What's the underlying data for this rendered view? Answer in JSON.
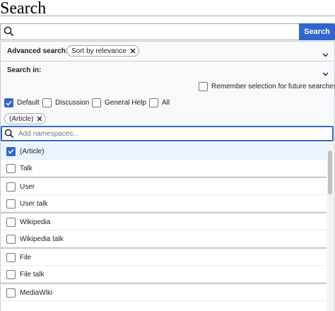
{
  "page": {
    "title": "Search"
  },
  "search": {
    "value": "",
    "button_label": "Search"
  },
  "advanced": {
    "label": "Advanced search:",
    "chip_label": "Sort by relevance"
  },
  "search_in": {
    "label": "Search in:",
    "remember_label": "Remember selection for future searches",
    "options": [
      {
        "label": "Default",
        "checked": true
      },
      {
        "label": "Discussion",
        "checked": false
      },
      {
        "label": "General Help",
        "checked": false
      },
      {
        "label": "All",
        "checked": false
      }
    ],
    "selected_chip": "(Article)",
    "namespace_placeholder": "Add namespaces..."
  },
  "namespaces": [
    {
      "label": "(Article)",
      "checked": true
    },
    {
      "label": "Talk",
      "checked": false
    },
    {
      "label": "User",
      "checked": false
    },
    {
      "label": "User talk",
      "checked": false
    },
    {
      "label": "Wikipedia",
      "checked": false
    },
    {
      "label": "Wikipedia talk",
      "checked": false
    },
    {
      "label": "File",
      "checked": false
    },
    {
      "label": "File talk",
      "checked": false
    },
    {
      "label": "MediaWiki",
      "checked": false
    }
  ],
  "colors": {
    "accent": "#3366cc",
    "border": "#a2a9b1",
    "panel": "#f8f9fa"
  }
}
